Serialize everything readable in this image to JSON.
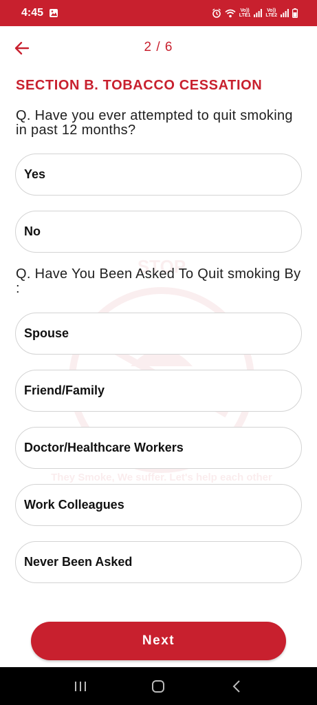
{
  "status_bar": {
    "time": "4:45",
    "sim1": "LTE1",
    "sim2": "LTE2",
    "volte": "Vo))"
  },
  "header": {
    "page_indicator": "2 / 6"
  },
  "section": {
    "title": "SECTION B. TOBACCO CESSATION"
  },
  "questions": [
    {
      "text": "Q. Have you ever attempted to quit smoking in past 12 months?",
      "options": [
        "Yes",
        "No"
      ]
    },
    {
      "text": "Q. Have You Been Asked To Quit smoking By :",
      "options": [
        "Spouse",
        "Friend/Family",
        "Doctor/Healthcare Workers",
        "Work Colleagues",
        "Never Been Asked"
      ]
    }
  ],
  "watermark": {
    "stop": "STOP",
    "caption": "They Smoke, We suffer. Let's help each other"
  },
  "footer": {
    "next_label": "Next"
  },
  "colors": {
    "brand": "#c8202e"
  }
}
